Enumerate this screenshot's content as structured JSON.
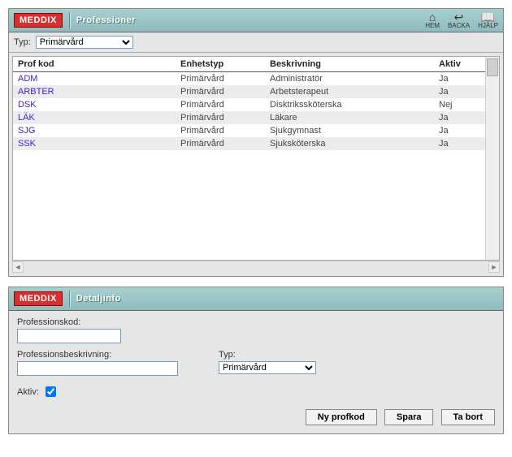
{
  "logo": "MEDDIX",
  "panel1": {
    "title": "Professioner",
    "toolbar": {
      "hem": "HEM",
      "backa": "BACKA",
      "hjalp": "HJÄLP"
    },
    "filter": {
      "label": "Typ:",
      "selected": "Primärvård",
      "options": [
        "Primärvård"
      ]
    },
    "columns": {
      "code": "Prof kod",
      "unit": "Enhetstyp",
      "desc": "Beskrivning",
      "active": "Aktiv"
    },
    "rows": [
      {
        "code": "ADM",
        "unit": "Primärvård",
        "desc": "Administratör",
        "active": "Ja"
      },
      {
        "code": "ARBTER",
        "unit": "Primärvård",
        "desc": "Arbetsterapeut",
        "active": "Ja"
      },
      {
        "code": "DSK",
        "unit": "Primärvård",
        "desc": "Disktrikssköterska",
        "active": "Nej"
      },
      {
        "code": "LÄK",
        "unit": "Primärvård",
        "desc": "Läkare",
        "active": "Ja"
      },
      {
        "code": "SJG",
        "unit": "Primärvård",
        "desc": "Sjukgymnast",
        "active": "Ja"
      },
      {
        "code": "SSK",
        "unit": "Primärvård",
        "desc": "Sjuksköterska",
        "active": "Ja"
      }
    ]
  },
  "panel2": {
    "title": "Detaljinfo",
    "fields": {
      "code_label": "Professionskod:",
      "code_value": "",
      "desc_label": "Professionsbeskrivning:",
      "desc_value": "",
      "typ_label": "Typ:",
      "typ_selected": "Primärvård"
    },
    "aktiv": {
      "label": "Aktiv:",
      "checked": true
    },
    "buttons": {
      "ny": "Ny profkod",
      "spara": "Spara",
      "tabort": "Ta bort"
    }
  }
}
